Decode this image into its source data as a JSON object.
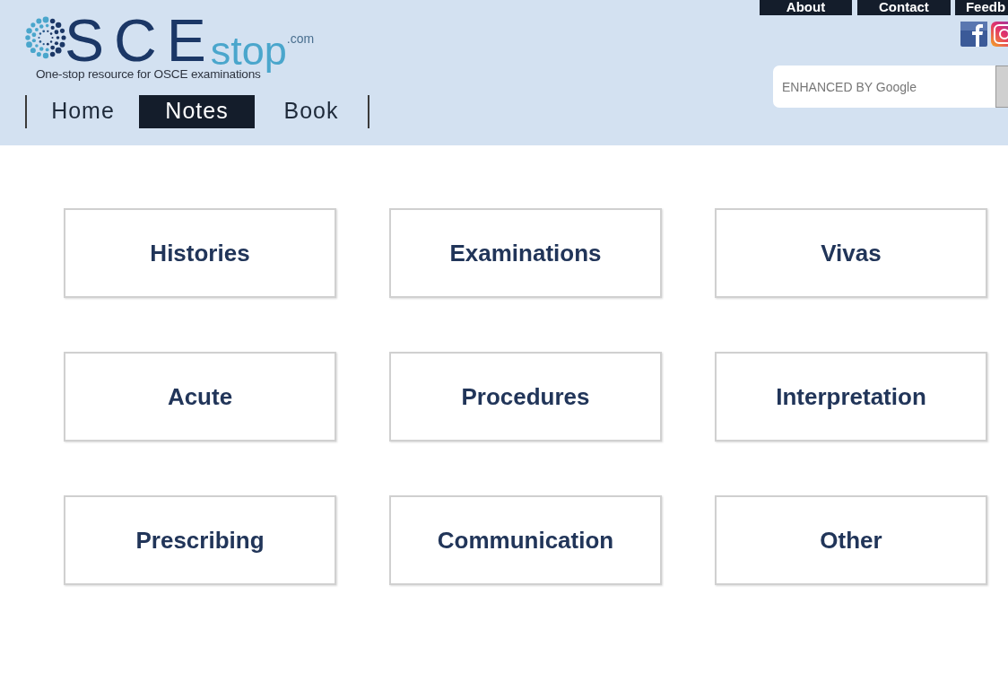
{
  "header": {
    "logo": {
      "main": "SCE",
      "accent": "stop",
      "suffix": ".com",
      "tagline": "One-stop resource for OSCE examinations"
    },
    "nav": [
      {
        "label": "Home",
        "selected": false
      },
      {
        "label": "Notes",
        "selected": true
      },
      {
        "label": "Book",
        "selected": false
      }
    ],
    "top_links": [
      "About",
      "Contact",
      "Feedb"
    ],
    "search": {
      "placeholder": "ENHANCED BY Google"
    }
  },
  "categories": [
    "Histories",
    "Examinations",
    "Vivas",
    "Acute",
    "Procedures",
    "Interpretation",
    "Prescribing",
    "Communication",
    "Other"
  ]
}
